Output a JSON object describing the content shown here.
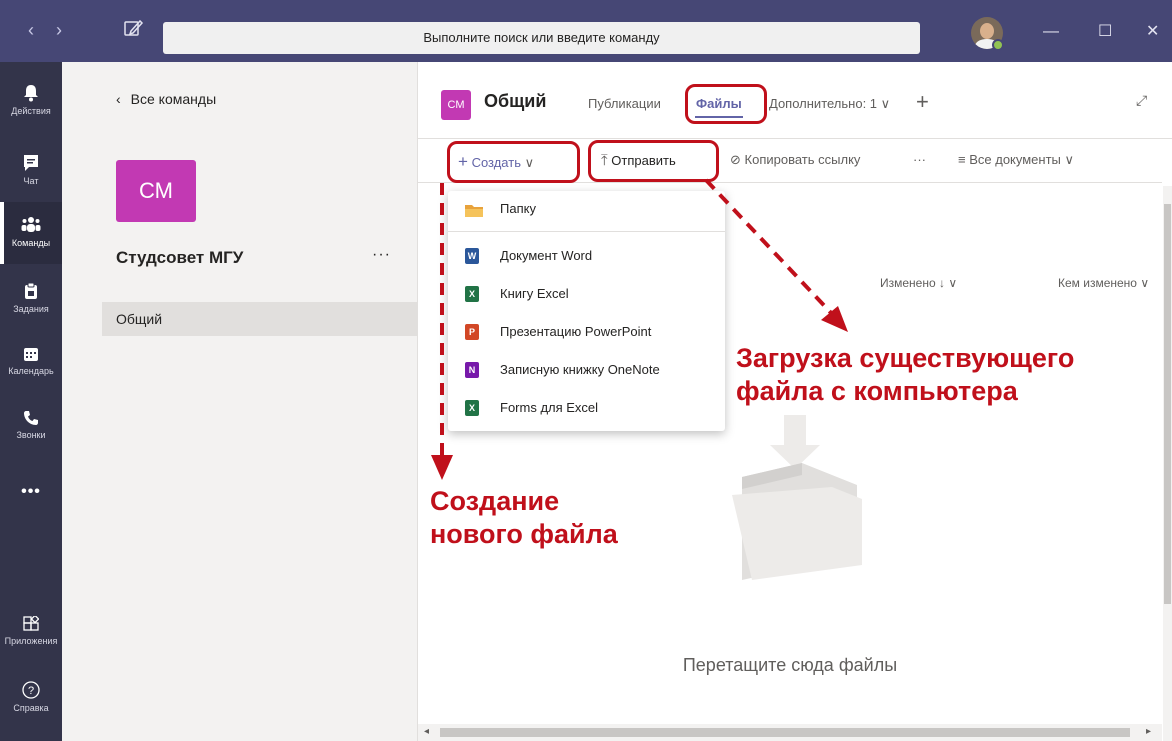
{
  "titlebar": {
    "back_glyph": "‹",
    "forward_glyph": "›",
    "search_placeholder": "Выполните поиск или введите команду",
    "window_controls": {
      "minimize": "—",
      "maximize": "☐",
      "close": "✕"
    }
  },
  "rail": {
    "items": [
      {
        "label": "Действия",
        "icon": "bell-icon",
        "glyph": "🔔"
      },
      {
        "label": "Чат",
        "icon": "chat-icon",
        "glyph": "💬"
      },
      {
        "label": "Команды",
        "icon": "teams-icon",
        "glyph": "👥"
      },
      {
        "label": "Задания",
        "icon": "assignments-icon",
        "glyph": "📋"
      },
      {
        "label": "Календарь",
        "icon": "calendar-icon",
        "glyph": "📅"
      },
      {
        "label": "Звонки",
        "icon": "phone-icon",
        "glyph": "✆"
      },
      {
        "label": "",
        "icon": "more-icon",
        "glyph": "•••"
      },
      {
        "label": "Приложения",
        "icon": "apps-icon",
        "glyph": "⊞"
      },
      {
        "label": "Справка",
        "icon": "help-icon",
        "glyph": "?"
      }
    ]
  },
  "teams_panel": {
    "back_label": "Все команды",
    "team_initials": "СМ",
    "team_name": "Студсовет МГУ",
    "more_glyph": "···",
    "channel": "Общий"
  },
  "channel_header": {
    "initials": "СМ",
    "title": "Общий",
    "tabs": [
      {
        "label": "Публикации",
        "active": false
      },
      {
        "label": "Файлы",
        "active": true
      },
      {
        "label": "Дополнительно: 1 ∨",
        "active": false
      }
    ],
    "add_tab": "+",
    "expand": "⤢"
  },
  "toolbar": {
    "create": "Создать",
    "upload": "Отправить",
    "copy_link": "Копировать ссылку",
    "more": "···",
    "view": "Все документы"
  },
  "columns": {
    "modified": "Изменено ↓ ∨",
    "modified_by": "Кем изменено ∨"
  },
  "create_menu": {
    "items": [
      {
        "label": "Папку",
        "icon": "folder-icon",
        "color": "#e8a23b",
        "glyph": ""
      },
      {
        "label": "Документ Word",
        "icon": "word-icon",
        "color": "#2b579a",
        "glyph": "W"
      },
      {
        "label": "Книгу Excel",
        "icon": "excel-icon",
        "color": "#217346",
        "glyph": "X"
      },
      {
        "label": "Презентацию PowerPoint",
        "icon": "powerpoint-icon",
        "color": "#d24726",
        "glyph": "P"
      },
      {
        "label": "Записную книжку OneNote",
        "icon": "onenote-icon",
        "color": "#7719aa",
        "glyph": "N"
      },
      {
        "label": "Forms для Excel",
        "icon": "forms-excel-icon",
        "color": "#217346",
        "glyph": "X"
      }
    ]
  },
  "drop_zone": "Перетащите сюда файлы",
  "annotations": {
    "upload_caption": [
      "Загрузка существующего",
      "файла с компьютера"
    ],
    "create_caption": [
      "Создание",
      "нового файла"
    ],
    "color": "#c0101b"
  },
  "colors": {
    "titlebar": "#464775",
    "rail": "#33344a",
    "accent": "#6264a7",
    "team_tile": "#c239b3"
  }
}
